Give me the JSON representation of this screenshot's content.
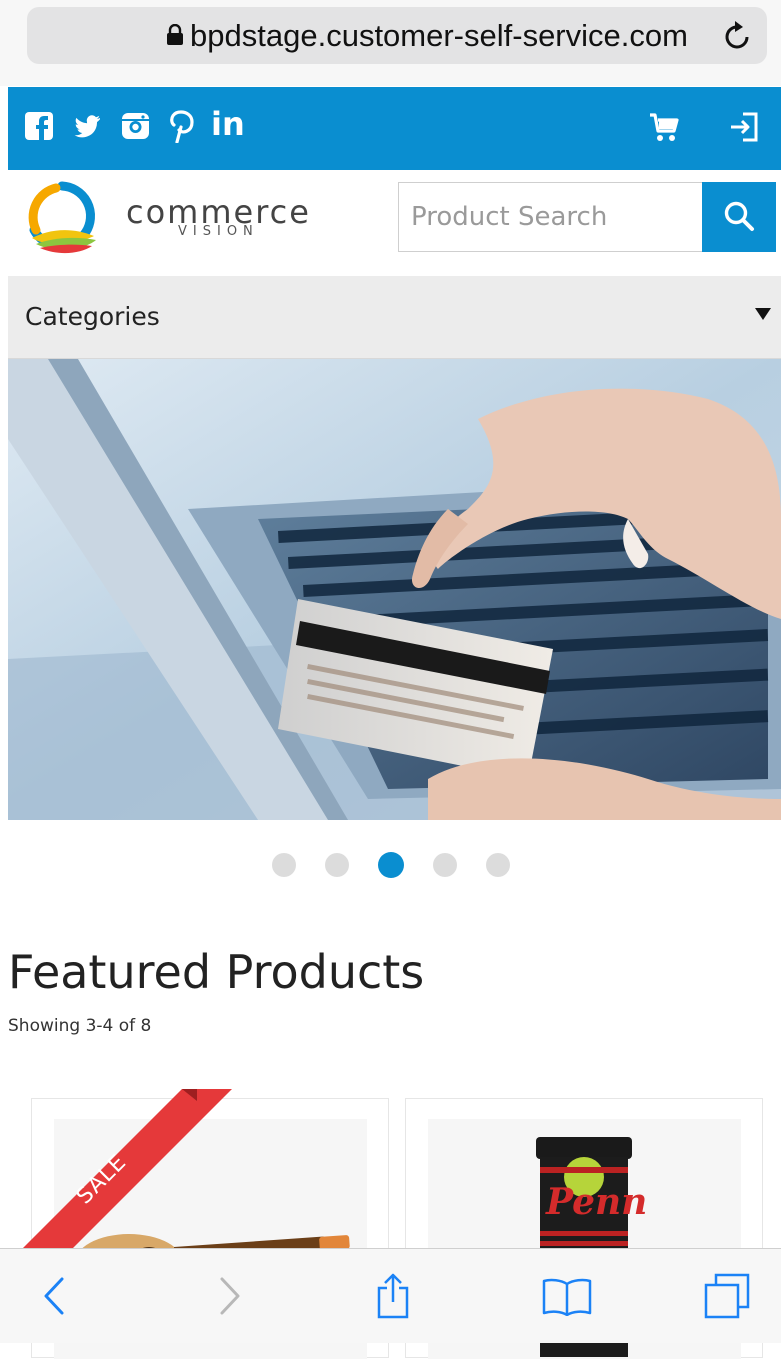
{
  "browser": {
    "url": "bpdstage.customer-self-service.com"
  },
  "topbar": {
    "social_icons": [
      "facebook-icon",
      "twitter-icon",
      "instagram-icon",
      "pinterest-icon",
      "linkedin-icon"
    ],
    "linkedin_label": "in",
    "right_icons": [
      "cart-icon",
      "login-icon"
    ]
  },
  "header": {
    "logo_word": "commerce",
    "logo_sub": "VISION",
    "search_placeholder": "Product Search"
  },
  "categories": {
    "label": "Categories"
  },
  "carousel": {
    "slide_count": 5,
    "active_index": 2
  },
  "featured": {
    "title": "Featured Products",
    "count_text": "Showing 3-4 of 8",
    "products": [
      {
        "badge": "SALE",
        "image": "acoustic-guitar"
      },
      {
        "image": "penn-tennis-ball-can",
        "brand_text": "Penn"
      }
    ]
  },
  "colors": {
    "brand_blue": "#0a8ed0",
    "sale_red": "#e5393a"
  }
}
